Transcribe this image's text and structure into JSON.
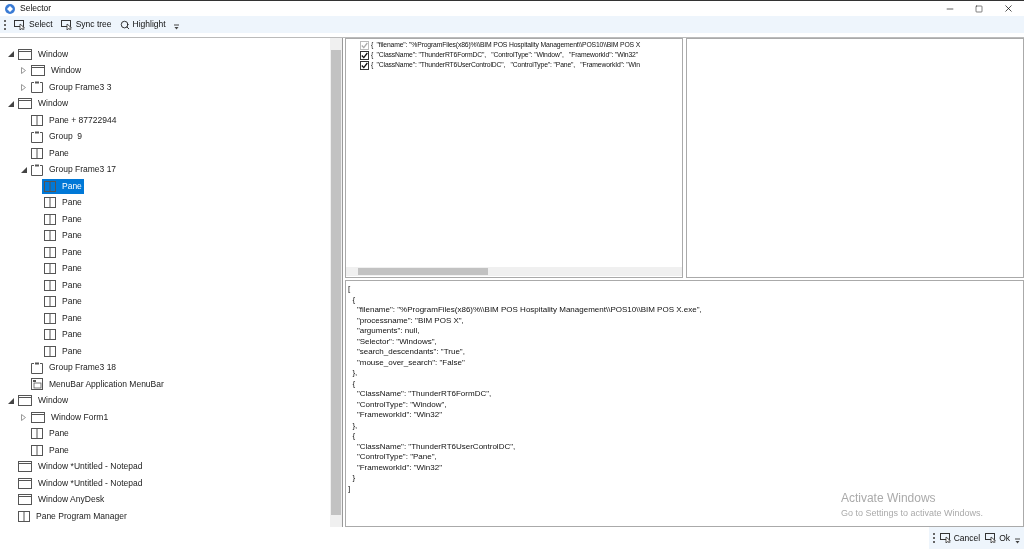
{
  "window": {
    "title": "Selector"
  },
  "toolbar": [
    {
      "kind": "pick",
      "label": "Select"
    },
    {
      "kind": "pick",
      "label": "Sync tree"
    },
    {
      "kind": "search",
      "label": "Highlight"
    }
  ],
  "tree": [
    {
      "label": "Window",
      "kind": "window",
      "expanded": true,
      "selected": false,
      "children": [
        {
          "label": "Window",
          "kind": "window",
          "expanded": false,
          "selected": false
        },
        {
          "label": "Group Frame3 3",
          "kind": "group",
          "expanded": false,
          "selected": false
        }
      ]
    },
    {
      "label": "Window",
      "kind": "window",
      "expanded": true,
      "selected": false,
      "children": [
        {
          "label": "Pane + 87722944",
          "kind": "pane",
          "selected": false
        },
        {
          "label": "Group  9",
          "kind": "group",
          "selected": false
        },
        {
          "label": "Pane",
          "kind": "pane",
          "selected": false
        },
        {
          "label": "Group Frame3 17",
          "kind": "group",
          "expanded": true,
          "selected": false,
          "children": [
            {
              "label": "Pane",
              "kind": "pane",
              "selected": true
            },
            {
              "label": "Pane",
              "kind": "pane",
              "selected": false
            },
            {
              "label": "Pane",
              "kind": "pane",
              "selected": false
            },
            {
              "label": "Pane",
              "kind": "pane",
              "selected": false
            },
            {
              "label": "Pane",
              "kind": "pane",
              "selected": false
            },
            {
              "label": "Pane",
              "kind": "pane",
              "selected": false
            },
            {
              "label": "Pane",
              "kind": "pane",
              "selected": false
            },
            {
              "label": "Pane",
              "kind": "pane",
              "selected": false
            },
            {
              "label": "Pane",
              "kind": "pane",
              "selected": false
            },
            {
              "label": "Pane",
              "kind": "pane",
              "selected": false
            },
            {
              "label": "Pane",
              "kind": "pane",
              "selected": false
            }
          ]
        },
        {
          "label": "Group Frame3 18",
          "kind": "group",
          "selected": false
        },
        {
          "label": "MenuBar Application MenuBar",
          "kind": "menubar",
          "selected": false
        }
      ]
    },
    {
      "label": "Window",
      "kind": "window",
      "expanded": true,
      "selected": false,
      "children": [
        {
          "label": "Window Form1",
          "kind": "window",
          "expanded": false,
          "selected": false
        },
        {
          "label": "Pane",
          "kind": "pane",
          "selected": false
        },
        {
          "label": "Pane",
          "kind": "pane",
          "selected": false
        }
      ]
    },
    {
      "label": "Window *Untitled - Notepad",
      "kind": "window",
      "selected": false
    },
    {
      "label": "Window *Untitled - Notepad",
      "kind": "window",
      "selected": false
    },
    {
      "label": "Window AnyDesk",
      "kind": "window",
      "selected": false
    },
    {
      "label": "Pane Program Manager",
      "kind": "pane",
      "selected": false
    }
  ],
  "selector_items": [
    {
      "text": "{  \"filename\": \"%ProgramFiles(x86)%\\\\BIM POS Hospitality Management\\\\POS10\\\\BIM POS X",
      "checked": true,
      "disabled": true
    },
    {
      "text": "{  \"ClassName\": \"ThunderRT6FormDC\",   \"ControlType\": \"Window\",   \"FrameworkId\": \"Win32\"",
      "checked": true,
      "disabled": false
    },
    {
      "text": "{  \"ClassName\": \"ThunderRT6UserControlDC\",   \"ControlType\": \"Pane\",   \"FrameworkId\": \"Win",
      "checked": true,
      "disabled": false
    }
  ],
  "editor_lines": [
    "[",
    "  {",
    "    \"filename\": \"%ProgramFiles(x86)%\\\\BIM POS Hospitality Management\\\\POS10\\\\BIM POS X.exe\",",
    "    \"processname\": \"BIM POS X\",",
    "    \"arguments\": null,",
    "    \"Selector\": \"Windows\",",
    "    \"search_descendants\": \"True\",",
    "    \"mouse_over_search\": \"False\"",
    "  },",
    "  {",
    "    \"ClassName\": \"ThunderRT6FormDC\",",
    "    \"ControlType\": \"Window\",",
    "    \"FrameworkId\": \"Win32\"",
    "  },",
    "  {",
    "    \"ClassName\": \"ThunderRT6UserControlDC\",",
    "    \"ControlType\": \"Pane\",",
    "    \"FrameworkId\": \"Win32\"",
    "  }",
    "]"
  ],
  "activation_notice": {
    "title": "Activate Windows",
    "subtitle": "Go to Settings to activate Windows."
  },
  "footer_buttons": [
    {
      "label": "Cancel"
    },
    {
      "label": "Ok"
    }
  ]
}
